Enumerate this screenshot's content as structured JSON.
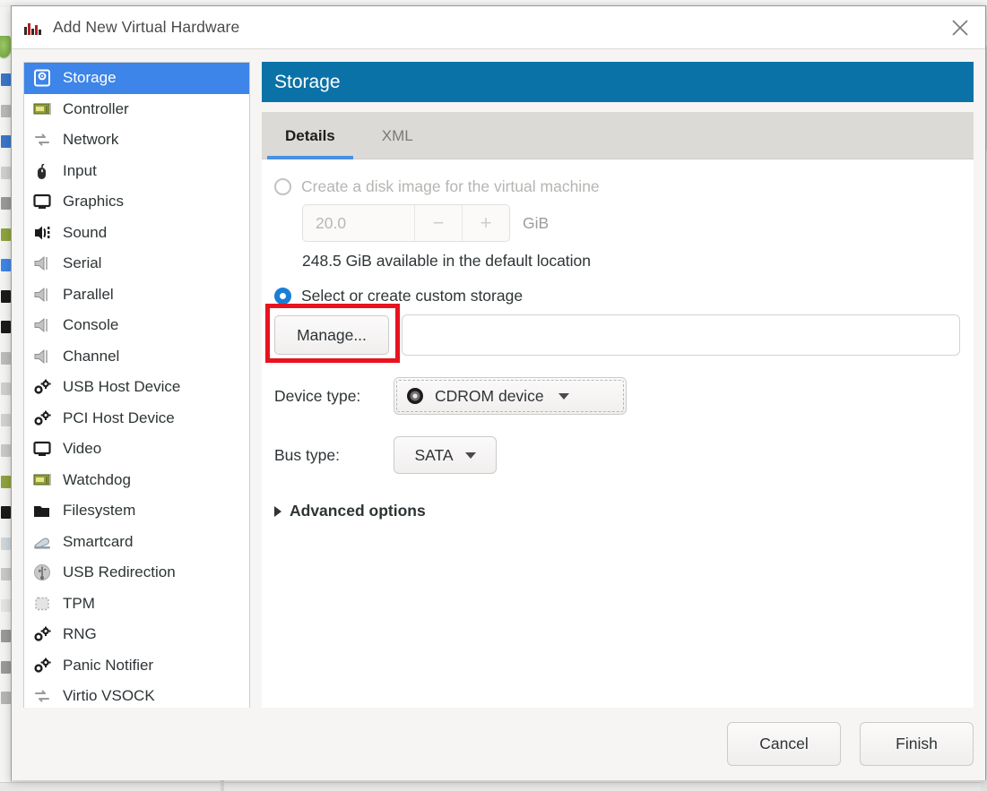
{
  "window": {
    "title": "Add New Virtual Hardware",
    "app_icon": "virt-manager-icon",
    "close_icon": "close-icon"
  },
  "sidebar": {
    "items": [
      {
        "label": "Storage",
        "icon": "storage-icon",
        "selected": true
      },
      {
        "label": "Controller",
        "icon": "controller-icon",
        "selected": false
      },
      {
        "label": "Network",
        "icon": "network-icon",
        "selected": false
      },
      {
        "label": "Input",
        "icon": "mouse-icon",
        "selected": false
      },
      {
        "label": "Graphics",
        "icon": "monitor-icon",
        "selected": false
      },
      {
        "label": "Sound",
        "icon": "sound-icon",
        "selected": false
      },
      {
        "label": "Serial",
        "icon": "serial-port-icon",
        "selected": false
      },
      {
        "label": "Parallel",
        "icon": "parallel-port-icon",
        "selected": false
      },
      {
        "label": "Console",
        "icon": "console-port-icon",
        "selected": false
      },
      {
        "label": "Channel",
        "icon": "channel-port-icon",
        "selected": false
      },
      {
        "label": "USB Host Device",
        "icon": "gears-icon",
        "selected": false
      },
      {
        "label": "PCI Host Device",
        "icon": "gears-icon",
        "selected": false
      },
      {
        "label": "Video",
        "icon": "monitor-icon",
        "selected": false
      },
      {
        "label": "Watchdog",
        "icon": "controller-icon",
        "selected": false
      },
      {
        "label": "Filesystem",
        "icon": "folder-icon",
        "selected": false
      },
      {
        "label": "Smartcard",
        "icon": "smartcard-icon",
        "selected": false
      },
      {
        "label": "USB Redirection",
        "icon": "usb-icon",
        "selected": false
      },
      {
        "label": "TPM",
        "icon": "chip-icon",
        "selected": false
      },
      {
        "label": "RNG",
        "icon": "gears-icon",
        "selected": false
      },
      {
        "label": "Panic Notifier",
        "icon": "gears-icon",
        "selected": false
      },
      {
        "label": "Virtio VSOCK",
        "icon": "network-icon",
        "selected": false
      }
    ]
  },
  "section": {
    "header": "Storage",
    "header_color": "#0b72a8"
  },
  "tabs": [
    {
      "label": "Details",
      "active": true
    },
    {
      "label": "XML",
      "active": false
    }
  ],
  "storage": {
    "create_disk_label": "Create a disk image for the virtual machine",
    "create_disk_selected": false,
    "create_disk_enabled": false,
    "size_value": "20.0",
    "size_unit": "GiB",
    "spin_minus": "−",
    "spin_plus": "+",
    "available_text": "248.5 GiB available in the default location",
    "custom_storage_label": "Select or create custom storage",
    "custom_storage_selected": true,
    "manage_button": "Manage...",
    "path_value": "",
    "path_placeholder": "",
    "device_type_label": "Device type:",
    "device_type_value": "CDROM device",
    "device_type_icon": "cdrom-icon",
    "bus_type_label": "Bus type:",
    "bus_type_value": "SATA",
    "advanced_options_label": "Advanced options"
  },
  "footer": {
    "cancel_label": "Cancel",
    "finish_label": "Finish"
  },
  "highlight": {
    "target": "manage-button",
    "color": "#e8131f"
  }
}
